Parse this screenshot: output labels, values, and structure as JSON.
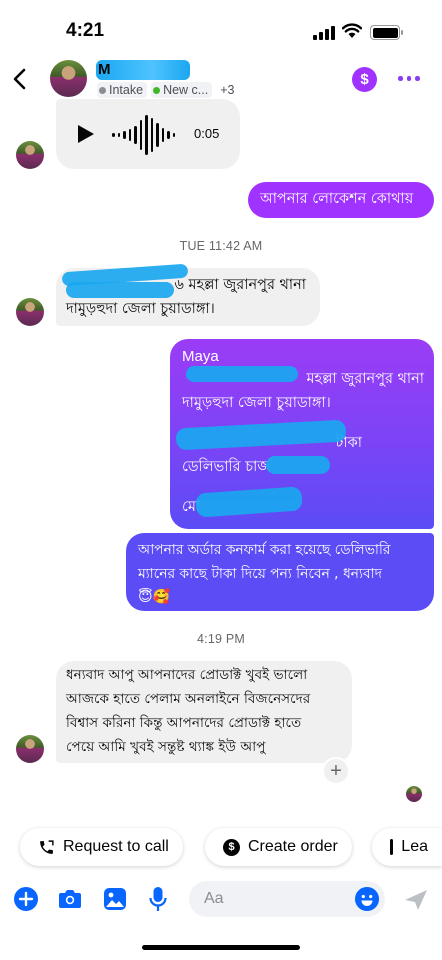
{
  "status_bar": {
    "time": "4:21"
  },
  "header": {
    "contact_name": "M",
    "labels": [
      {
        "text": "Intake",
        "color": "#8a8d91"
      },
      {
        "text": "New c...",
        "color": "#42b72a"
      }
    ],
    "more_labels": "+3",
    "dollar_symbol": "$"
  },
  "messages": {
    "voice": {
      "duration": "0:05"
    },
    "out_location": "আপনার লোকেশন কোথায়",
    "timestamp_1": "TUE 11:42 AM",
    "in_address_line1": "৬ মহল্লা জুরানপুর থানা",
    "in_address_line2": "দামুড়হুদা জেলা চুয়াডাঙ্গা।",
    "quoted_name": "Maya",
    "quoted_line1": "মহল্লা জুরানপুর থানা",
    "quoted_line2": "দামুড়হুদা জেলা চুয়াডাঙ্গা।",
    "quoted_line3": "টাকা",
    "quoted_line4": "ডেলিভারি চার্জ",
    "quoted_line5": "মো",
    "out_confirm_line1": "আপনার অর্ডার কনফার্ম  করা হয়েছে ডেলিভারি",
    "out_confirm_line2": "ম্যানের কাছে টাকা দিয়ে পন্য নিবেন , ধন্যবাদ",
    "out_confirm_emoji": "😇🥰",
    "timestamp_2": "4:19 PM",
    "in_thanks_line1": "ধন্যবাদ আপু আপনাদের প্রোডাক্ট খুবই ভালো",
    "in_thanks_line2": "আজকে হাতে পেলাম অনলাইনে বিজনেসদের",
    "in_thanks_line3": "বিশ্বাস করিনা কিন্তু আপনাদের প্রোডাক্ট হাতে",
    "in_thanks_line4": "পেয়ে আমি খুবই সন্তুষ্ট থ্যাঙ্ক ইউ আপু",
    "reaction_add": "+"
  },
  "quick_replies": [
    {
      "label": "Request to call",
      "icon": "phone-icon"
    },
    {
      "label": "Create order",
      "icon": "dollar-icon"
    },
    {
      "label": "Lea",
      "icon": "document-icon"
    }
  ],
  "composer": {
    "placeholder": "Aa"
  },
  "colors": {
    "accent_purple": "#a033ff",
    "messenger_blue": "#0866ff",
    "gradient_top": "#9b3cf6",
    "gradient_bottom": "#5b4cf5"
  }
}
